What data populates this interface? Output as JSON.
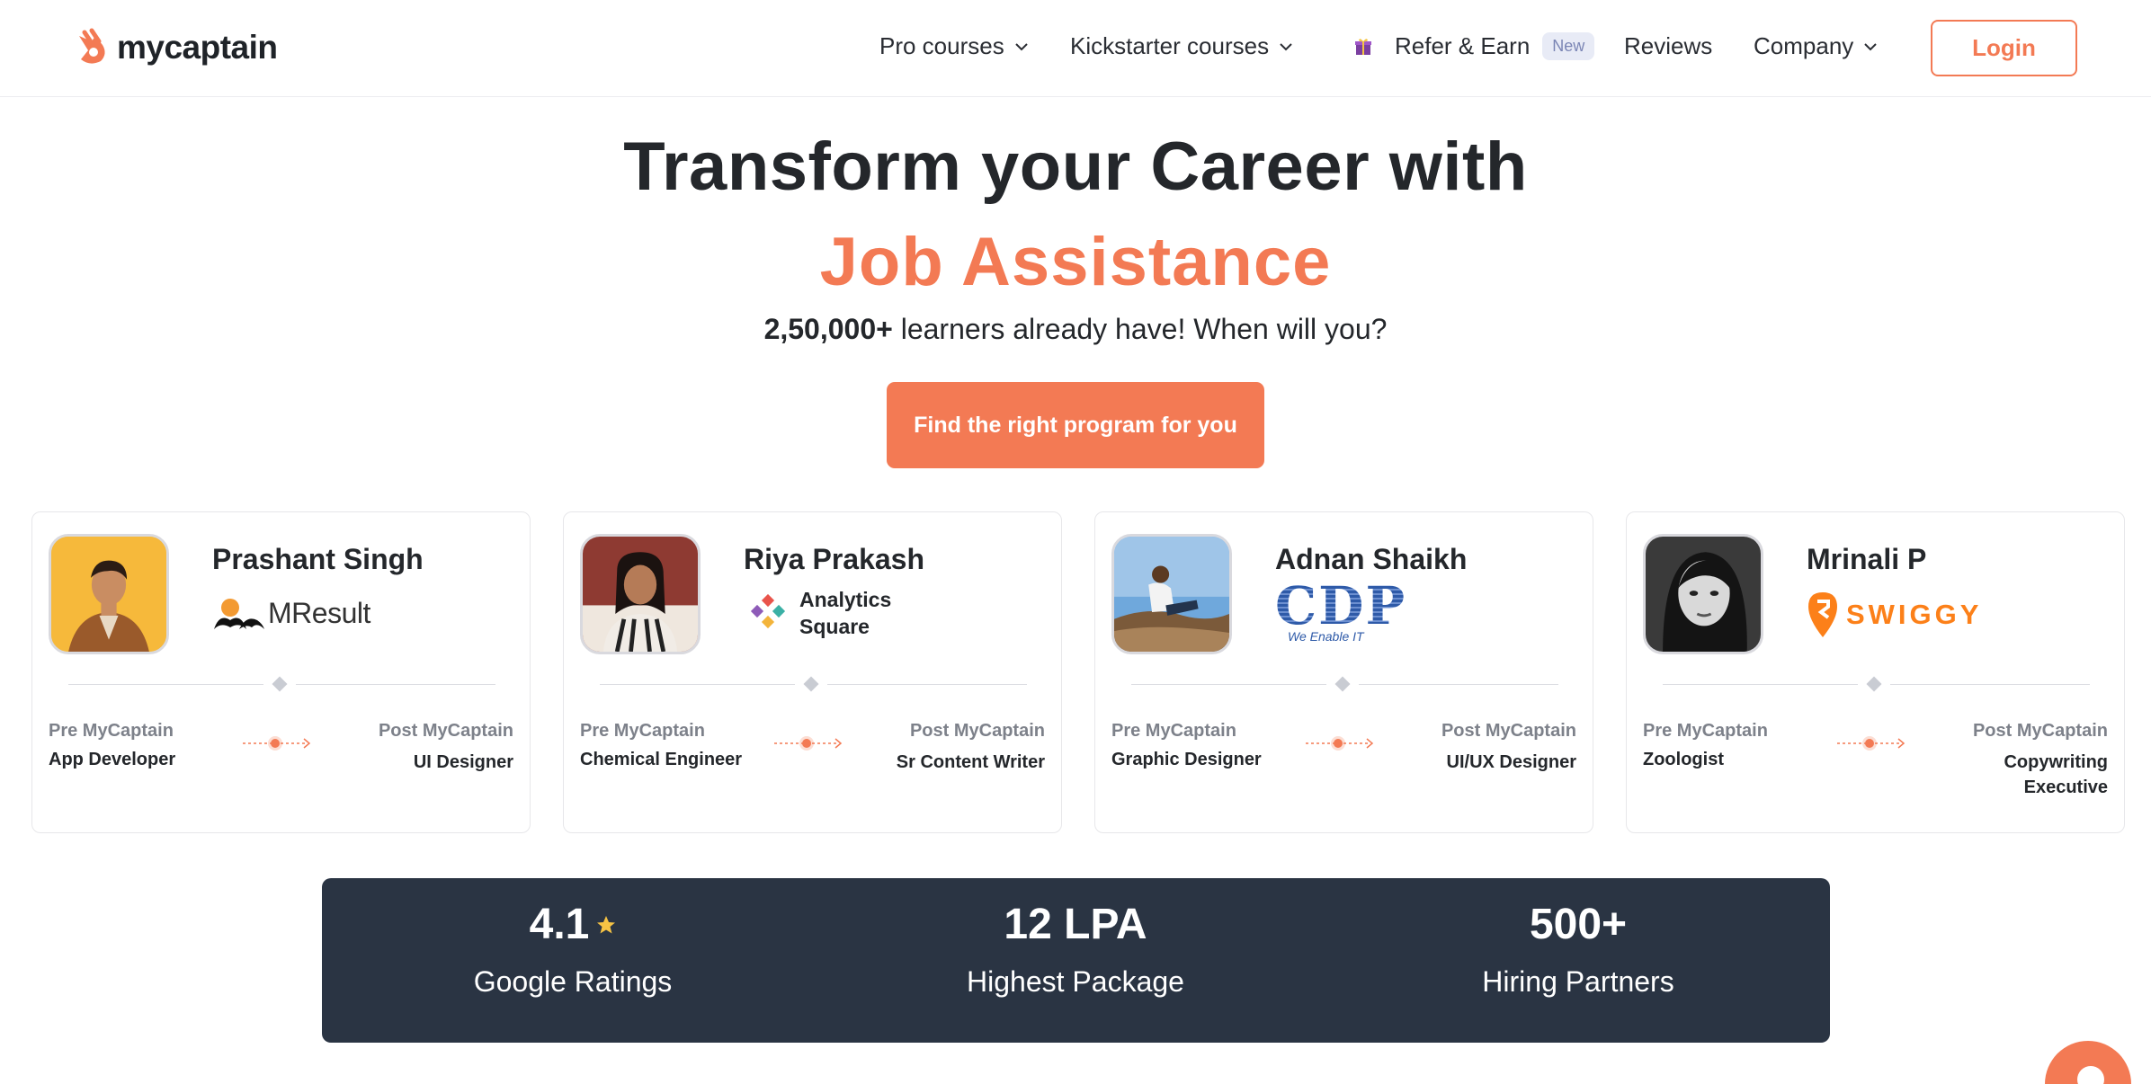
{
  "header": {
    "logo_text": "mycaptain",
    "nav": {
      "pro_courses": "Pro courses",
      "kickstarter_courses": "Kickstarter courses",
      "refer_earn": "Refer & Earn",
      "refer_badge": "New",
      "reviews": "Reviews",
      "company": "Company"
    },
    "login": "Login"
  },
  "hero": {
    "title": "Transform your Career with",
    "accent": "Job Assistance",
    "sub_bold": "2,50,000+",
    "sub_rest": " learners already have! When will you?",
    "cta": "Find the right program for you"
  },
  "cards": [
    {
      "name": "Prashant Singh",
      "company": "MResult",
      "pre_label": "Pre MyCaptain",
      "pre_value": "App Developer",
      "post_label": "Post MyCaptain",
      "post_value": "UI Designer"
    },
    {
      "name": "Riya Prakash",
      "company": "Analytics Square",
      "company_line1": "Analytics",
      "company_line2": "Square",
      "pre_label": "Pre MyCaptain",
      "pre_value": "Chemical Engineer",
      "post_label": "Post MyCaptain",
      "post_value": "Sr Content Writer"
    },
    {
      "name": "Adnan Shaikh",
      "company": "CDP",
      "company_tagline": "We Enable IT",
      "pre_label": "Pre MyCaptain",
      "pre_value": "Graphic Designer",
      "post_label": "Post MyCaptain",
      "post_value": "UI/UX Designer"
    },
    {
      "name": "Mrinali P",
      "company": "SWIGGY",
      "pre_label": "Pre MyCaptain",
      "pre_value": "Zoologist",
      "post_label": "Post MyCaptain",
      "post_value_line1": "Copywriting",
      "post_value_line2": "Executive"
    }
  ],
  "stats": [
    {
      "value": "4.1",
      "label": "Google Ratings"
    },
    {
      "value": "12 LPA",
      "label": "Highest Package"
    },
    {
      "value": "500+",
      "label": "Hiring Partners"
    }
  ],
  "colors": {
    "accent": "#f37a54",
    "dark_panel": "#2a3443",
    "text": "#24272b",
    "muted": "#7d818a"
  }
}
